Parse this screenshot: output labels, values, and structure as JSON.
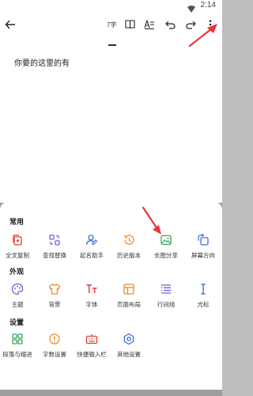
{
  "status_bar": {
    "time": "2:14",
    "wifi_icon": "wifi-icon"
  },
  "toolbar": {
    "back_icon": "back-arrow-icon",
    "word_count": "7字",
    "book_icon": "book-icon",
    "format_icon": "text-format-icon",
    "undo_icon": "undo-icon",
    "redo_icon": "redo-icon",
    "more_icon": "more-vertical-icon"
  },
  "editor": {
    "text": "你要的这里的有"
  },
  "sheet": {
    "common": {
      "title": "常用",
      "items": [
        {
          "label": "全文复制",
          "icon": "copy-icon"
        },
        {
          "label": "查找替换",
          "icon": "find-replace-icon"
        },
        {
          "label": "起名助手",
          "icon": "name-helper-icon"
        },
        {
          "label": "历史版本",
          "icon": "history-icon"
        },
        {
          "label": "长图分享",
          "icon": "image-share-icon"
        },
        {
          "label": "屏幕方向",
          "icon": "rotate-screen-icon"
        }
      ]
    },
    "appearance": {
      "title": "外观",
      "items": [
        {
          "label": "主题",
          "icon": "palette-icon"
        },
        {
          "label": "背景",
          "icon": "shirt-icon"
        },
        {
          "label": "字体",
          "icon": "font-icon"
        },
        {
          "label": "页面布局",
          "icon": "layout-icon"
        },
        {
          "label": "行间线",
          "icon": "line-spacing-icon"
        },
        {
          "label": "光标",
          "icon": "cursor-icon"
        }
      ]
    },
    "settings": {
      "title": "设置",
      "items": [
        {
          "label": "段落与缩进",
          "icon": "paragraph-icon"
        },
        {
          "label": "字数设置",
          "icon": "word-count-setting-icon"
        },
        {
          "label": "快捷输入栏",
          "icon": "quick-input-icon"
        },
        {
          "label": "其他设置",
          "icon": "settings-gear-icon"
        }
      ]
    }
  },
  "colors": {
    "blue": "#3b6fd9",
    "orange": "#f08a24",
    "green": "#3aa55c",
    "purple": "#7a5ad8",
    "red_annotation": "#e53935"
  }
}
